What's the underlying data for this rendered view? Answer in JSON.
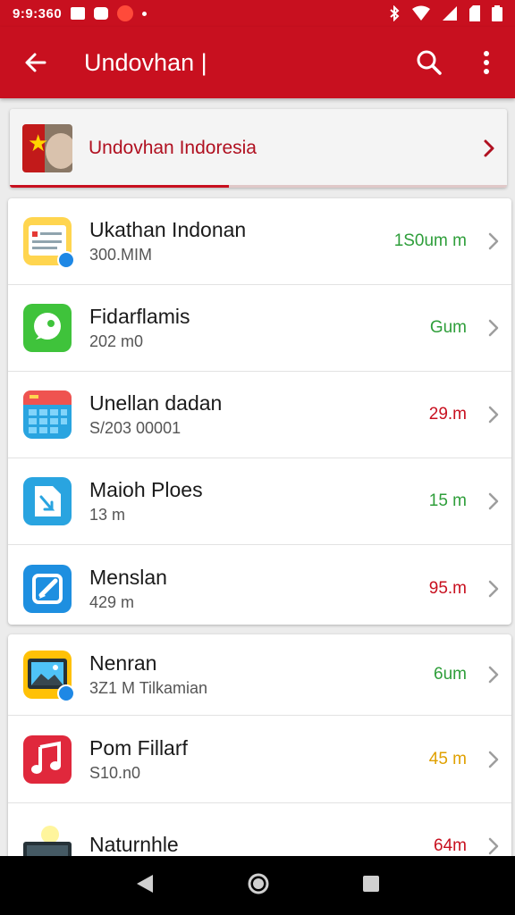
{
  "status_bar": {
    "time": "9:9:360"
  },
  "app_bar": {
    "title": "Undovhan |"
  },
  "banner": {
    "text": "Undovhan Indoresia"
  },
  "list1": [
    {
      "name": "Ukathan Indonan",
      "sub": "300.MIM",
      "value": "1S0um m",
      "value_color": "#2e9e3a",
      "icon": "form-document-icon"
    },
    {
      "name": "Fidarflamis",
      "sub": "202 m0",
      "value": "Gum",
      "value_color": "#2e9e3a",
      "icon": "chat-bubble-icon"
    },
    {
      "name": "Unellan dadan",
      "sub": "S/203 00001",
      "value": "29.m",
      "value_color": "#c8101f",
      "icon": "calendar-grid-icon"
    },
    {
      "name": "Maioh Ploes",
      "sub": "13 m",
      "value": "15 m",
      "value_color": "#2e9e3a",
      "icon": "document-arrow-icon"
    },
    {
      "name": "Menslan",
      "sub": "429 m",
      "value": "95.m",
      "value_color": "#c8101f",
      "icon": "edit-pencil-icon"
    }
  ],
  "list2": [
    {
      "name": "Nenran",
      "sub": "3Z1 M Tilkamian",
      "value": "6um",
      "value_color": "#2e9e3a",
      "icon": "photo-gallery-icon"
    },
    {
      "name": "Pom Fillarf",
      "sub": "S10.n0",
      "value": "45 m",
      "value_color": "#e0a000",
      "icon": "music-note-icon"
    },
    {
      "name": "Naturnhle",
      "sub": "",
      "value": "64m",
      "value_color": "#c8101f",
      "icon": "tablet-icon"
    }
  ]
}
